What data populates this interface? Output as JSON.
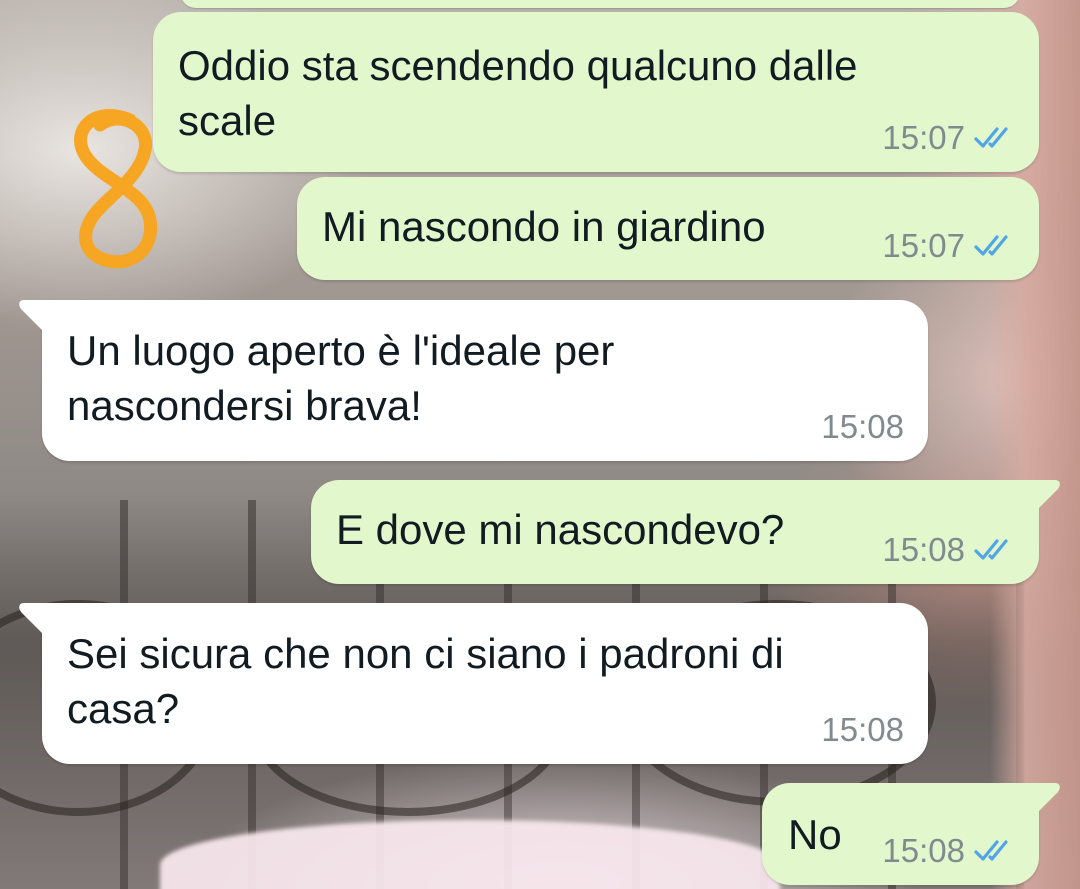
{
  "chat": {
    "messages": [
      {
        "direction": "outgoing",
        "text": "Oddio sta scendendo qualcuno dalle\nscale",
        "time": "15:07",
        "status": "read",
        "status_icon": "double-check-read-icon"
      },
      {
        "direction": "outgoing",
        "text": "Mi nascondo in giardino",
        "time": "15:07",
        "status": "read",
        "status_icon": "double-check-read-icon"
      },
      {
        "direction": "incoming",
        "text": "Un luogo aperto è l'ideale per\nnascondersi brava!",
        "time": "15:08"
      },
      {
        "direction": "outgoing",
        "text": "E dove mi nascondevo?",
        "time": "15:08",
        "status": "read",
        "status_icon": "double-check-read-icon"
      },
      {
        "direction": "incoming",
        "text": "Sei sicura che non ci siano i padroni di\ncasa?",
        "time": "15:08"
      },
      {
        "direction": "outgoing",
        "text": "No",
        "time": "15:08",
        "status": "read",
        "status_icon": "double-check-read-icon"
      }
    ],
    "doodle": {
      "text": "8",
      "color": "#f6a623"
    }
  },
  "colors": {
    "outgoing_bubble": "#e2f7cb",
    "incoming_bubble": "#ffffff",
    "read_tick": "#4fa5e8",
    "time_text": "#808a8f",
    "message_text": "#111b21"
  }
}
